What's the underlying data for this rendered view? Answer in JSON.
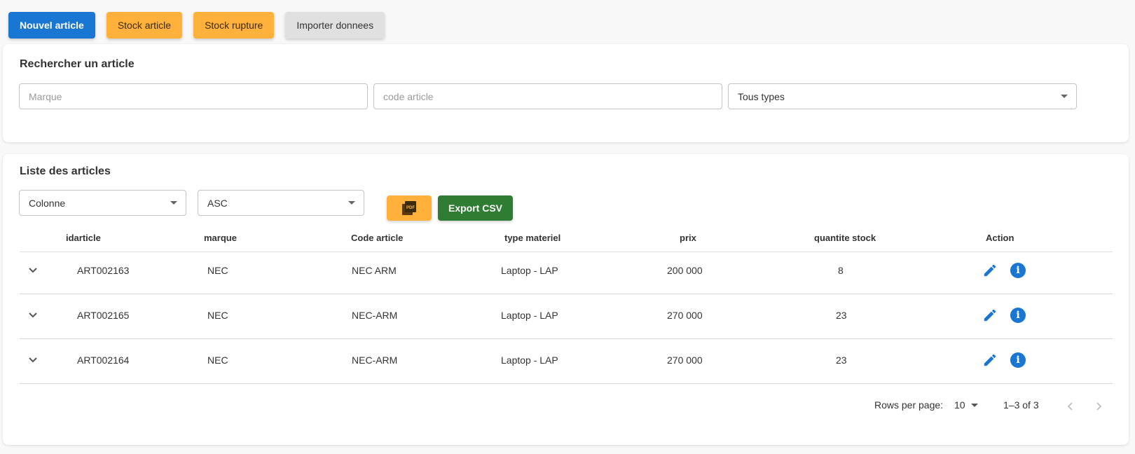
{
  "toolbar": {
    "new_label": "Nouvel article",
    "stock_label": "Stock article",
    "rupture_label": "Stock rupture",
    "import_label": "Importer donnees"
  },
  "search": {
    "title": "Rechercher un article",
    "marque_placeholder": "Marque",
    "code_placeholder": "code article",
    "type_value": "Tous types"
  },
  "list": {
    "title": "Liste des articles",
    "sort_column": "Colonne",
    "sort_order": "ASC",
    "pdf_label": "PDF",
    "csv_label": "Export CSV",
    "columns": [
      "idarticle",
      "marque",
      "Code article",
      "type materiel",
      "prix",
      "quantite stock",
      "Action"
    ],
    "rows": [
      {
        "id": "ART002163",
        "marque": "NEC",
        "code": "NEC ARM",
        "type": "Laptop - LAP",
        "prix": "200 000",
        "qty": "8"
      },
      {
        "id": "ART002165",
        "marque": "NEC",
        "code": "NEC-ARM",
        "type": "Laptop - LAP",
        "prix": "270 000",
        "qty": "23"
      },
      {
        "id": "ART002164",
        "marque": "NEC",
        "code": "NEC-ARM",
        "type": "Laptop - LAP",
        "prix": "270 000",
        "qty": "23"
      }
    ],
    "info_glyph": "i"
  },
  "pagination": {
    "rows_label": "Rows per page:",
    "rows_value": "10",
    "range": "1–3 of 3"
  },
  "colors": {
    "primary": "#1976d2",
    "orange": "#ffb13b",
    "green": "#2e7d32"
  }
}
